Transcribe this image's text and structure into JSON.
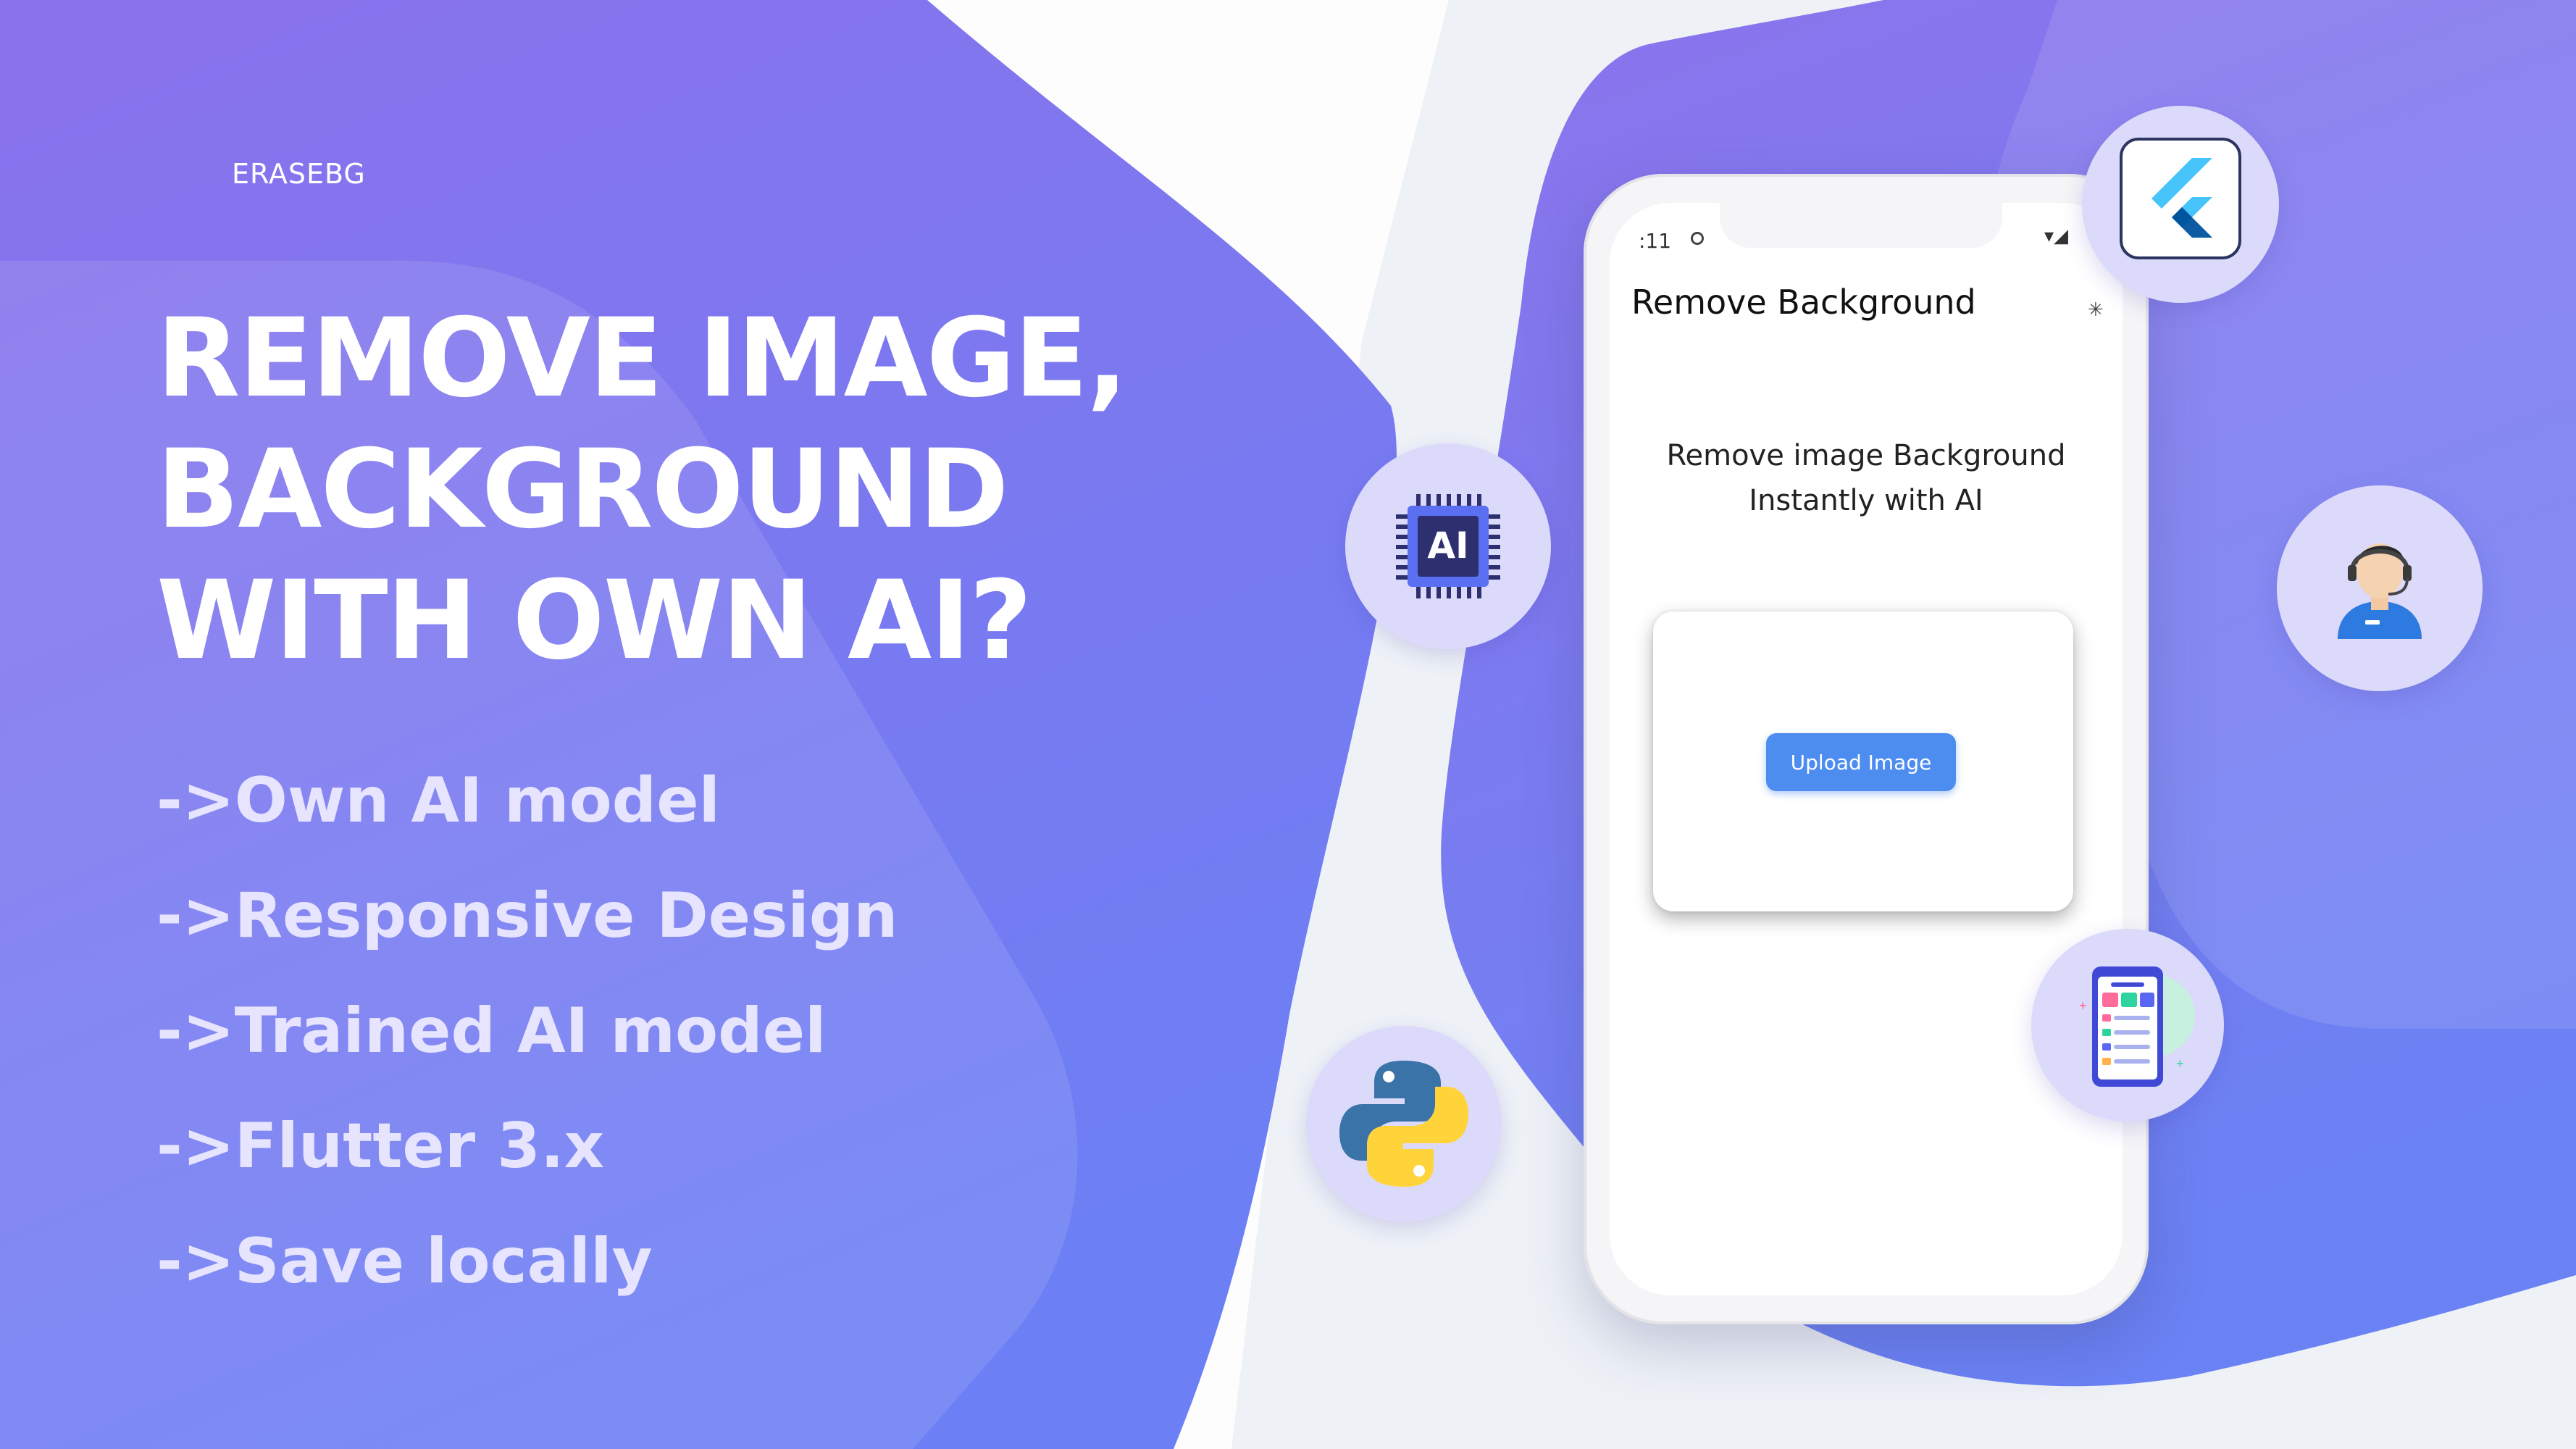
{
  "brand": "ERASEBG",
  "headline": [
    "REMOVE IMAGE,",
    "BACKGROUND",
    "WITH OWN AI?"
  ],
  "features": [
    "->Own AI model",
    "->Responsive Design",
    "->Trained AI model",
    "->Flutter 3.x",
    "->Save locally"
  ],
  "phone": {
    "status_time": ":11",
    "app_title": "Remove Background",
    "subtitle_line1": "Remove image Background",
    "subtitle_line2": "Instantly with AI",
    "upload_button": "Upload Image"
  },
  "badges": {
    "ai_chip_label": "AI",
    "icons": [
      "ai-chip-icon",
      "flutter-logo-icon",
      "support-agent-icon",
      "mobile-app-icon",
      "python-logo-icon"
    ]
  },
  "colors": {
    "purple_dark": "#8b74ec",
    "purple_light": "#7585f5",
    "button_blue": "#4d8df0",
    "badge_bg": "#dcdafb"
  }
}
